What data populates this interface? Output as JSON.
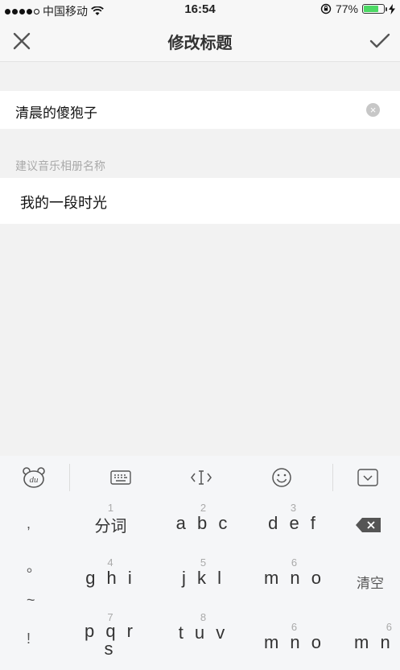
{
  "status": {
    "carrier": "中国移动",
    "time": "16:54",
    "battery": "77%",
    "battery_level": 0.77
  },
  "nav": {
    "title": "修改标题"
  },
  "title_field": {
    "value": "清晨的傻狍子"
  },
  "suggestion": {
    "hint": "建议音乐相册名称",
    "item": "我的一段时光"
  },
  "keyboard": {
    "symbols": [
      ",",
      "。",
      "~",
      "!"
    ],
    "rows": [
      [
        {
          "num": "1",
          "label": "分词"
        },
        {
          "num": "2",
          "label": "a b c"
        },
        {
          "num": "3",
          "label": "d e f"
        }
      ],
      [
        {
          "num": "4",
          "label": "g h i"
        },
        {
          "num": "5",
          "label": "j k l"
        },
        {
          "num": "6",
          "label": "m n o"
        }
      ],
      [
        {
          "num": "7",
          "label": "p q r s"
        },
        {
          "num": "8",
          "label": "t u v"
        },
        {
          "num": "6",
          "label": "m n o"
        }
      ]
    ],
    "clear_label": "清空",
    "partial_right": "m n"
  }
}
